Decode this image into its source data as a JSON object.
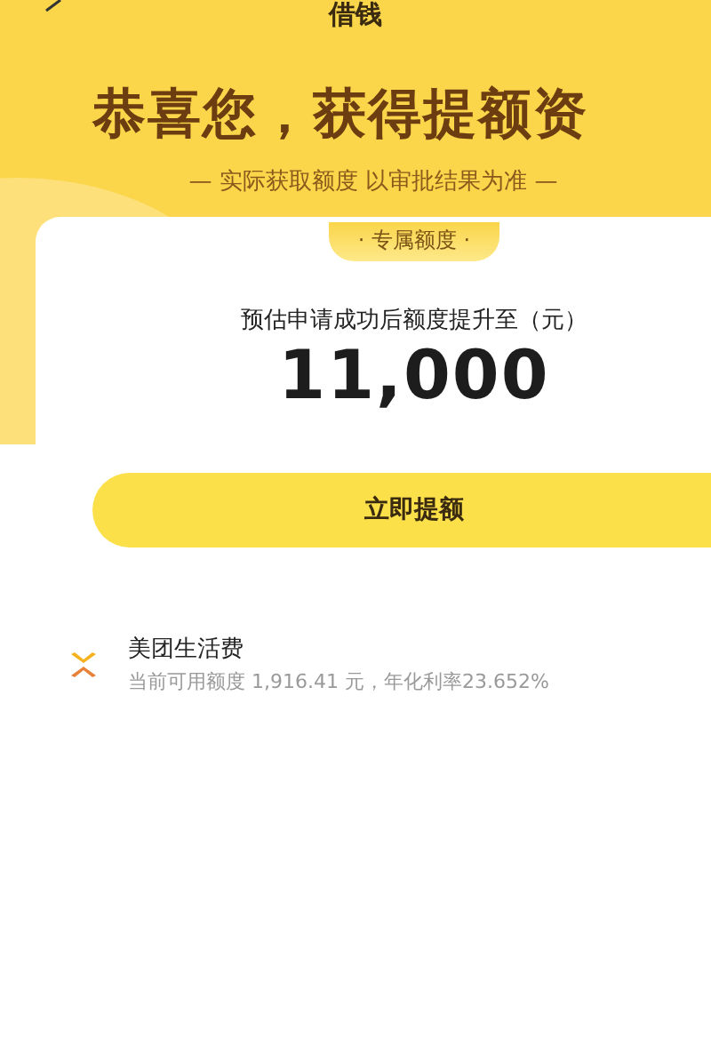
{
  "header": {
    "title": "借钱"
  },
  "banner": {
    "headline": "恭喜您，获得提额资",
    "subtitle": "— 实际获取额度 以审批结果为准 —"
  },
  "card": {
    "tag": "· 专属额度 ·",
    "label": "预估申请成功后额度提升至（元）",
    "amount": "11,000",
    "button": "立即提额"
  },
  "products": [
    {
      "name": "美团生活费",
      "detail": "当前可用额度 1,916.41 元，年化利率23.652%"
    }
  ]
}
